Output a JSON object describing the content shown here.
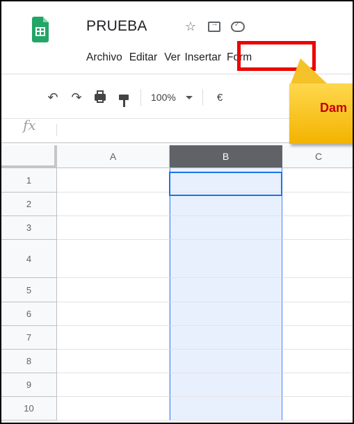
{
  "document": {
    "title": "PRUEBA"
  },
  "title_icons": [
    "star-icon",
    "move-to-folder-icon",
    "cloud-saved-icon"
  ],
  "menu": {
    "items": [
      "Archivo",
      "Editar",
      "Ver",
      "Insertar",
      "Form"
    ],
    "highlighted": "Insertar"
  },
  "toolbar": {
    "zoom": "100%",
    "currency": "€",
    "icons": [
      "undo-icon",
      "redo-icon",
      "print-icon",
      "paint-format-icon"
    ]
  },
  "callout": {
    "text": "Dam"
  },
  "formula_bar": {
    "fx": "fx"
  },
  "sheet": {
    "columns": [
      "A",
      "B",
      "C"
    ],
    "selected_column": "B",
    "rows": [
      "1",
      "2",
      "3",
      "4",
      "5",
      "6",
      "7",
      "8",
      "9",
      "10"
    ]
  },
  "colors": {
    "highlight_box": "#ee0000",
    "callout": "#f5bd00",
    "selection": "#e8f0fe",
    "sheets_green": "#23a566"
  }
}
